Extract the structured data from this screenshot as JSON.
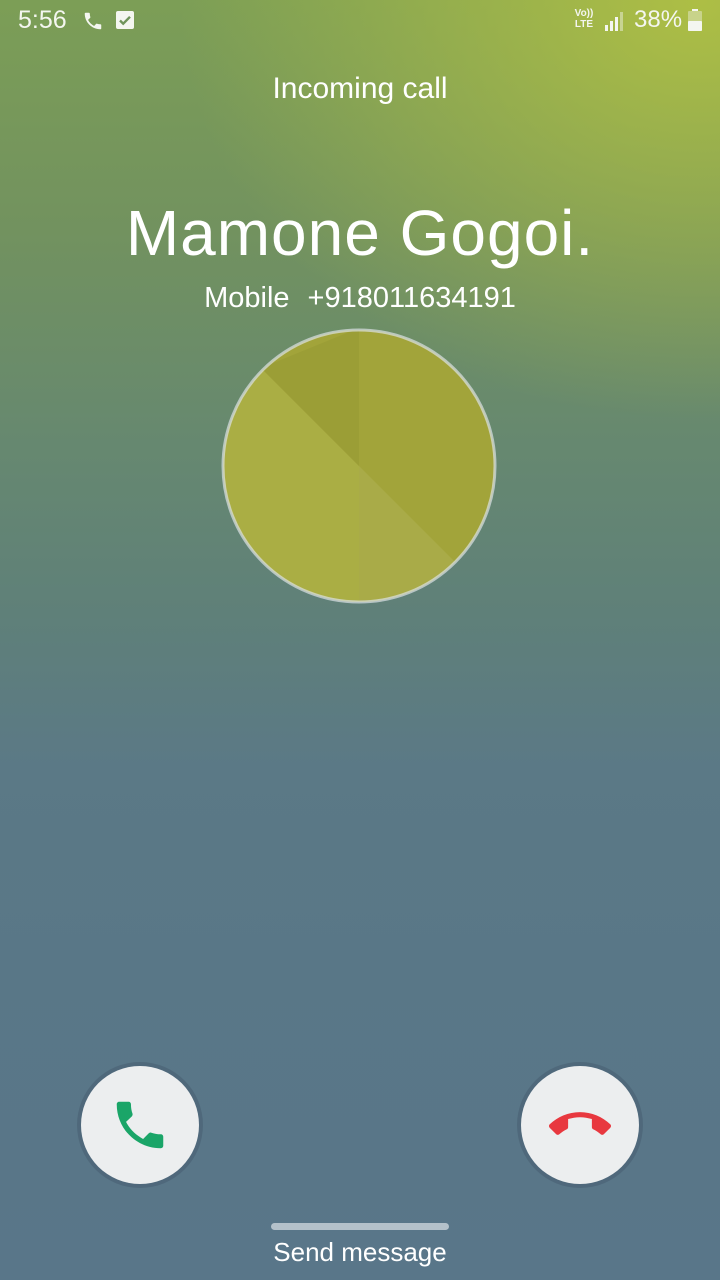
{
  "status_bar": {
    "time": "5:56",
    "volte_line1": "Vo))",
    "volte_line2": "LTE",
    "battery": "38%",
    "icons": [
      "phone-icon",
      "task-check-icon",
      "signal-icon",
      "battery-icon"
    ]
  },
  "call": {
    "status": "Incoming call",
    "caller_name": "Mamone Gogoi.",
    "number_type": "Mobile",
    "number": "+918011634191"
  },
  "actions": {
    "answer_icon": "phone-answer-icon",
    "decline_icon": "phone-decline-icon",
    "send_message": "Send message"
  },
  "colors": {
    "answer": "#1aa568",
    "decline": "#e8383f",
    "avatar": "#a3a43c"
  }
}
